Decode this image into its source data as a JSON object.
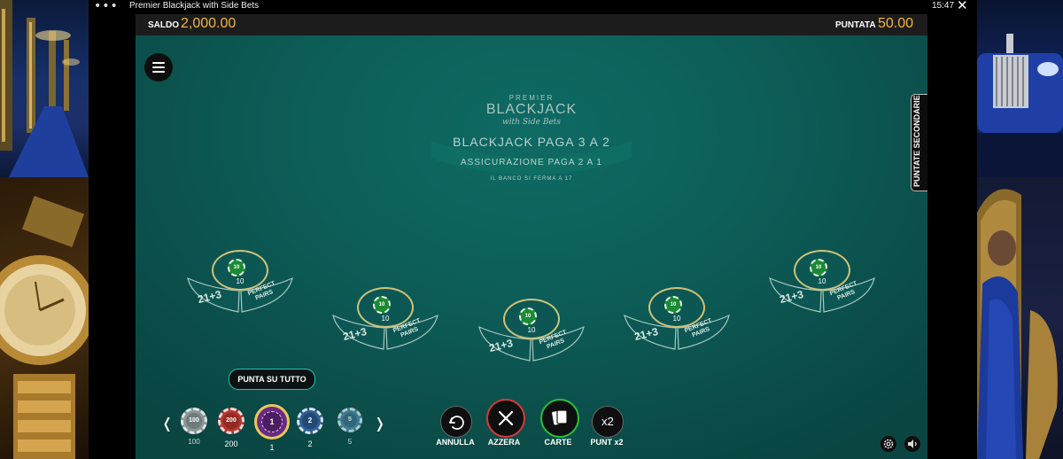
{
  "window": {
    "title": "Premier Blackjack with Side Bets",
    "time": "15:47"
  },
  "topbar": {
    "saldo_label": "SALDO",
    "saldo_value": "2,000.00",
    "puntata_label": "PUNTATA",
    "puntata_value": "50.00"
  },
  "side_tab": {
    "label": "PUNTATE SECONDARIE"
  },
  "table": {
    "brand_top": "PREMIER",
    "brand_main": "BLACKJACK",
    "brand_sub": "with Side Bets",
    "payout": "BLACKJACK PAGA 3 A 2",
    "insurance": "ASSICURAZIONE PAGA 2 A 1",
    "dealer_rule": "IL BANCO SI FERMA A 17"
  },
  "seats": [
    {
      "bet": "10",
      "chip_value": "10",
      "side1": "21+3",
      "side2": "PERFECT PAIRS"
    },
    {
      "bet": "10",
      "chip_value": "10",
      "side1": "21+3",
      "side2": "PERFECT PAIRS"
    },
    {
      "bet": "10",
      "chip_value": "10",
      "side1": "21+3",
      "side2": "PERFECT PAIRS"
    },
    {
      "bet": "10",
      "chip_value": "10",
      "side1": "21+3",
      "side2": "PERFECT PAIRS"
    },
    {
      "bet": "10",
      "chip_value": "10",
      "side1": "21+3",
      "side2": "PERFECT PAIRS"
    }
  ],
  "punta_tutto": "PUNTA SU TUTTO",
  "chips": [
    {
      "value": "100",
      "label": "100",
      "color": "#7f8c8c",
      "selected": false
    },
    {
      "value": "200",
      "label": "200",
      "color": "#b3362f",
      "selected": false
    },
    {
      "value": "1",
      "label": "1",
      "color": "#6a2a86",
      "selected": true
    },
    {
      "value": "2",
      "label": "2",
      "color": "#2f5f93",
      "selected": false
    },
    {
      "value": "5",
      "label": "5",
      "color": "#4c86a3",
      "selected": false
    }
  ],
  "actions": {
    "annulla": "ANNULLA",
    "azzera": "AZZERA",
    "carte": "CARTE",
    "punt_x2": "PUNT x2",
    "x2_icon_text": "x2"
  }
}
